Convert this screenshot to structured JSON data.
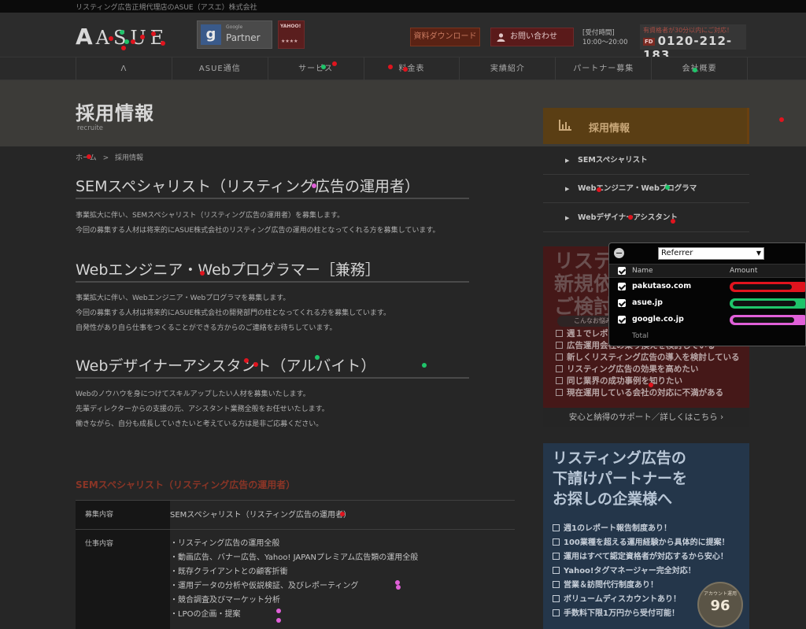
{
  "topbar": {
    "tagline": "リスティング広告正規代理店のASUE（アスエ）株式会社"
  },
  "header": {
    "logo_text": "ASUE",
    "logo_mark": "A",
    "google_badge": {
      "line1": "Google",
      "line2": "Partner"
    },
    "yahoo_badge": {
      "line1": "YAHOO!",
      "line2": "★★★★"
    },
    "download_button": "資料ダウンロード",
    "contact_button": "お問い合わせ",
    "hours_label": "[受付時間]",
    "hours_value": "10:00～20:00",
    "tel_note": "有資格者が30分以内にご対応！",
    "tel_prefix": "FD",
    "tel_number": "0120-212-183"
  },
  "nav": {
    "items": [
      "ASUE通信",
      "サービス",
      "料金表",
      "実績紹介",
      "パートナー募集",
      "会社概要"
    ],
    "home_icon": "asue-mark-icon"
  },
  "page_title": {
    "title": "採用情報",
    "subtitle": "recruite"
  },
  "breadcrumb": {
    "home": "ホーム",
    "sep": ">",
    "current": "採用情報"
  },
  "sections": [
    {
      "heading": "SEMスペシャリスト（リスティング広告の運用者）",
      "lines": [
        "事業拡大に伴い、SEMスペシャリスト（リスティング広告の運用者）を募集します。",
        "今回の募集する人材は将来的にASUE株式会社のリスティング広告の運用の柱となってくれる方を募集しています。"
      ]
    },
    {
      "heading": "Webエンジニア・Webプログラマー［兼務］",
      "lines": [
        "事業拡大に伴い、Webエンジニア・Webプログラマを募集します。",
        "今回の募集する人材は将来的にASUE株式会社の開発部門の柱となってくれる方を募集しています。",
        "自発性があり自ら仕事をつくることができる方からのご連絡をお待ちしています。"
      ]
    },
    {
      "heading": "Webデザイナーアシスタント（アルバイト）",
      "lines": [
        "Webのノウハウを身につけてスキルアップしたい人材を募集いたします。",
        "先輩ディレクターからの支援の元、アシスタント業務全般をお任せいたします。",
        "働きながら、自分も成長していきたいと考えている方は是非ご応募ください。"
      ]
    }
  ],
  "job_table": {
    "title": "SEMスペシャリスト（リスティング広告の運用者）",
    "rows": [
      {
        "label": "募集内容",
        "value": "SEMスペシャリスト（リスティング広告の運用者）"
      },
      {
        "label": "仕事内容",
        "items": [
          "・リスティング広告の運用全般",
          "・動画広告、バナー広告、Yahoo! JAPANプレミアム広告類の運用全般",
          "・既存クライアントとの顧客折衝",
          "・運用データの分析や仮説検証、及びレポーティング",
          "・競合調査及びマーケット分析",
          "・LPOの企画・提案"
        ]
      }
    ]
  },
  "sidebar": {
    "heading": "採用情報",
    "heading_icon": "chart-icon",
    "links": [
      "SEMスペシャリスト",
      "Webエンジニア・Webプログラマ",
      "Webデザイナーアシスタント"
    ],
    "banner1": {
      "title_lines": [
        "リスティング広告の",
        "新規依頼",
        "ご検討"
      ],
      "pill": "こんなお悩み",
      "checks": [
        "週１でレポー",
        "広告運用会社の乗り換えを検討している",
        "新しくリスティング広告の導入を検討している",
        "リスティング広告の効果を高めたい",
        "同じ業界の成功事例を知りたい",
        "現在運用している会社の対応に不満がある"
      ],
      "footer": "安心と納得のサポート／詳しくはこちら ›"
    },
    "banner2": {
      "title_lines": [
        "リスティング広告の",
        "下請けパートナーを",
        "お探しの企業様へ"
      ],
      "checks": [
        "週1のレポート報告制度あり！",
        "100業種を超える運用経験から具体的に提案！",
        "運用はすべて認定資格者が対応するから安心！",
        "Yahoo!タグマネージャー完全対応！",
        "営業＆訪問代行制度あり！",
        "ボリュームディスカウントあり！",
        "手数料下限1万円から受付可能！"
      ],
      "badge_line1": "アカウント運用",
      "badge_line2": "96"
    }
  },
  "referrer_widget": {
    "selected": "Referrer",
    "col_name": "Name",
    "col_amount": "Amount",
    "rows": [
      {
        "name": "pakutaso.com",
        "color": "#e0141e",
        "level": 0.75
      },
      {
        "name": "asue.jp",
        "color": "#1fc46a",
        "level": 0.8
      },
      {
        "name": "google.co.jp",
        "color": "#e060d8",
        "level": 0.78
      }
    ],
    "total_label": "Total"
  }
}
